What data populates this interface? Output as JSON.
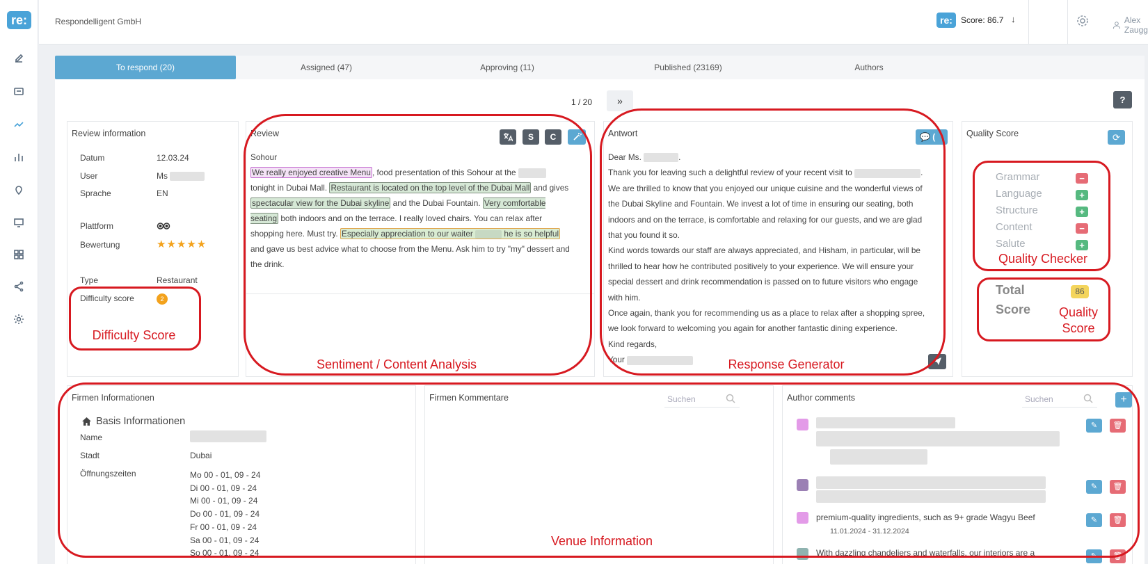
{
  "app": {
    "company": "Respondelligent GmbH",
    "score_label": "Score: 86.7",
    "score_trend_icon": "arrow-down-icon",
    "user": "Alex Zaugg"
  },
  "sidebar": {
    "items": [
      "edit-icon",
      "comment-icon",
      "trending-icon",
      "bar-chart-icon",
      "location-pin-icon",
      "monitor-icon",
      "grid-icon",
      "share-icon",
      "settings-icon"
    ]
  },
  "tabs": [
    {
      "label": "To respond (20)",
      "active": true
    },
    {
      "label": "Assigned (47)"
    },
    {
      "label": "Approving (11)"
    },
    {
      "label": "Published (23169)"
    },
    {
      "label": "Authors"
    }
  ],
  "pager": {
    "text": "1 / 20",
    "next": "»",
    "help": "?"
  },
  "review_info": {
    "title": "Review information",
    "datum_label": "Datum",
    "datum": "12.03.24",
    "user_label": "User",
    "user": "Ms",
    "sprache_label": "Sprache",
    "sprache": "EN",
    "plattform_label": "Plattform",
    "bewertung_label": "Bewertung",
    "stars": "★★★★★",
    "type_label": "Type",
    "type": "Restaurant",
    "difficulty_label": "Difficulty score",
    "difficulty": "2"
  },
  "review": {
    "title": "Review",
    "tools": [
      "S",
      "C"
    ],
    "heading": "Sohour",
    "seg1": "We really enjoyed creative Menu",
    "seg2": ", food presentation of this Sohour at the ",
    "seg3": " tonight in Dubai Mall. ",
    "seg4": "Restaurant is located on the top level of the Dubai Mall",
    "seg5": " and gives ",
    "seg6": "spectacular view for the Dubai skyline",
    "seg7": " and the Dubai Fountain. ",
    "seg8": "Very comfortable seating",
    "seg9": " both indoors and on the terrace. I really loved chairs. You can relax after shopping here. Must try. ",
    "seg10a": "Especially appreciation to our waiter ",
    "seg10b": " he is so helpful",
    "seg11": " and gave us best advice what to choose from the Menu. Ask him to try \"my\" dessert and the drink."
  },
  "answer": {
    "title": "Antwort",
    "chat_badge": "(",
    "p1": "Dear Ms.",
    "p2": "Thank you for leaving such a delightful review of your recent visit to",
    "p3": "We are thrilled to know that you enjoyed our unique cuisine and the wonderful views of the Dubai Skyline and Fountain. We invest a lot of time in ensuring our seating, both indoors and on the terrace, is comfortable and relaxing for our guests, and we are glad that you found it so.",
    "p4": "Kind words towards our staff are always appreciated, and Hisham, in particular, will be thrilled to hear how he contributed positively to your experience. We will ensure your special dessert and drink recommendation is passed on to future visitors who engage with him.",
    "p5": "Once again, thank you for recommending us as a place to relax after a shopping spree, we look forward to welcoming you again for another fantastic dining experience.",
    "p6": "Kind regards,",
    "p7": "Your"
  },
  "quality": {
    "title": "Quality Score",
    "rows": [
      {
        "label": "Grammar",
        "status": "−"
      },
      {
        "label": "Language",
        "status": "+"
      },
      {
        "label": "Structure",
        "status": "+"
      },
      {
        "label": "Content",
        "status": "−"
      },
      {
        "label": "Salute",
        "status": "+"
      }
    ],
    "total_line1": "Total",
    "total_line2": "Score",
    "total_value": "86"
  },
  "firmen_info": {
    "title": "Firmen Informationen",
    "section": "Basis Informationen",
    "name_label": "Name",
    "stadt_label": "Stadt",
    "stadt": "Dubai",
    "hours_label": "Öffnungszeiten",
    "hours": [
      "Mo 00 - 01, 09 - 24",
      "Di 00 - 01, 09 - 24",
      "Mi 00 - 01, 09 - 24",
      "Do 00 - 01, 09 - 24",
      "Fr 00 - 01, 09 - 24",
      "Sa 00 - 01, 09 - 24",
      "So 00 - 01, 09 - 24"
    ]
  },
  "firmen_kommentare": {
    "title": "Firmen Kommentare",
    "search_placeholder": "Suchen"
  },
  "author_comments": {
    "title": "Author comments",
    "search_placeholder": "Suchen",
    "items": [
      {
        "color": "#e39be8",
        "text": "",
        "date": ""
      },
      {
        "color": "#9b80b4",
        "text": "",
        "date": ""
      },
      {
        "color": "#e39be8",
        "text": "premium-quality ingredients, such as 9+ grade Wagyu Beef",
        "date": "11.01.2024 - 31.12.2024"
      },
      {
        "color": "#8fb3b0",
        "text": "With dazzling chandeliers and waterfalls, our interiors are a",
        "date": ""
      }
    ]
  },
  "annotations": {
    "difficulty": "Difficulty Score",
    "sentiment": "Sentiment / Content Analysis",
    "response": "Response Generator",
    "quality_checker": "Quality Checker",
    "quality_score_1": "Quality",
    "quality_score_2": "Score",
    "venue": "Venue Information"
  }
}
